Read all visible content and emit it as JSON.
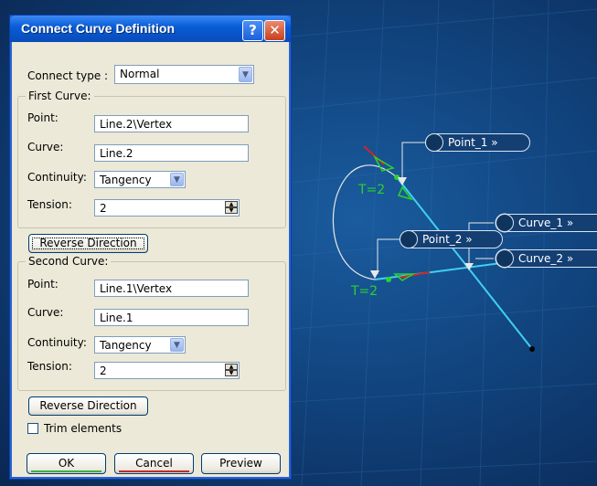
{
  "dialog": {
    "title": "Connect Curve Definition",
    "help_glyph": "?",
    "close_glyph": "✕",
    "connect_type_label": "Connect type :",
    "connect_type_value": "Normal",
    "first_curve": {
      "group_label": "First Curve:",
      "point_label": "Point:",
      "point_value": "Line.2\\Vertex",
      "curve_label": "Curve:",
      "curve_value": "Line.2",
      "continuity_label": "Continuity:",
      "continuity_value": "Tangency",
      "tension_label": "Tension:",
      "tension_value": "2"
    },
    "reverse_direction_1": "Reverse Direction",
    "second_curve": {
      "group_label": "Second Curve:",
      "point_label": "Point:",
      "point_value": "Line.1\\Vertex",
      "curve_label": "Curve:",
      "curve_value": "Line.1",
      "continuity_label": "Continuity:",
      "continuity_value": "Tangency",
      "tension_label": "Tension:",
      "tension_value": "2"
    },
    "reverse_direction_2": "Reverse Direction",
    "trim_label": "Trim elements",
    "trim_checked": false,
    "ok_label": "OK",
    "cancel_label": "Cancel",
    "preview_label": "Preview"
  },
  "viewport": {
    "point_1_tag": "Point_1 »",
    "point_2_tag": "Point_2 »",
    "curve_1_tag": "Curve_1 »",
    "curve_2_tag": "Curve_2 »",
    "tension_1": "T=2",
    "tension_2": "T=2"
  },
  "colors": {
    "line": "#3fd0f0",
    "connect_curve": "#e8e8e8",
    "tension_text": "#2bd32b",
    "tangent_arrow": "#d02424",
    "title_bar": "#0a5ed8"
  }
}
